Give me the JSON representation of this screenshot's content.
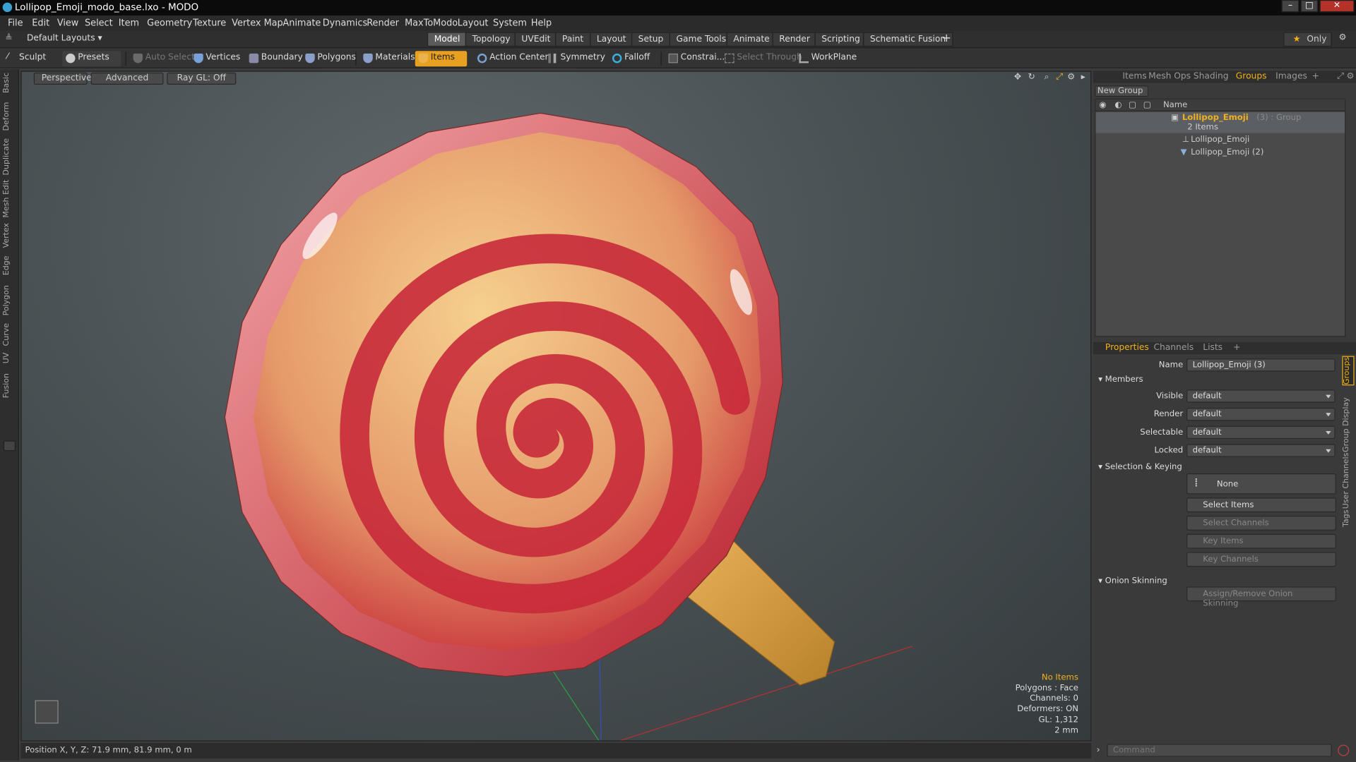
{
  "window": {
    "title": "Lollipop_Emoji_modo_base.lxo - MODO"
  },
  "menu": [
    "File",
    "Edit",
    "View",
    "Select",
    "Item",
    "Geometry",
    "Texture",
    "Vertex Map",
    "Animate",
    "Dynamics",
    "Render",
    "MaxToModo",
    "Layout",
    "System",
    "Help"
  ],
  "layout_select": "Default Layouts ▾",
  "layout_tabs": [
    "Model",
    "Topology",
    "UVEdit",
    "Paint",
    "Layout",
    "Setup",
    "Game Tools",
    "Animate",
    "Render",
    "Scripting",
    "Schematic Fusion"
  ],
  "only_label": "Only",
  "toolbar": {
    "sculpt": "Sculpt",
    "presets": "Presets",
    "auto_select": "Auto Select",
    "vertices": "Vertices",
    "boundary": "Boundary",
    "polygons": "Polygons",
    "materials": "Materials",
    "items": "Items",
    "action_center": "Action Center",
    "symmetry": "Symmetry",
    "falloff": "Falloff",
    "constraints": "Constrai...",
    "select_through": "Select Through",
    "workplane": "WorkPlane"
  },
  "left_tabs": [
    "Basic",
    "Deform",
    "Duplicate",
    "Mesh Edit",
    "Vertex",
    "Edge",
    "Polygon",
    "Curve",
    "UV",
    "Fusion"
  ],
  "viewport": {
    "perspective": "Perspective",
    "advanced": "Advanced",
    "raygl": "Ray GL: Off",
    "info": {
      "no_items": "No Items",
      "polygons": "Polygons : Face",
      "channels": "Channels: 0",
      "deformers": "Deformers: ON",
      "gl": "GL: 1,312",
      "scale": "2 mm"
    }
  },
  "status": {
    "position": "Position X, Y, Z:   71.9 mm, 81.9 mm, 0 m"
  },
  "right_panel": {
    "tabs": [
      "Items",
      "Mesh Ops",
      "Shading",
      "Groups",
      "Images"
    ],
    "new_group": "New Group",
    "name_col": "Name",
    "group": {
      "name": "Lollipop_Emoji",
      "suffix": "(3) : Group",
      "count": "2 Items",
      "children": [
        "Lollipop_Emoji",
        "Lollipop_Emoji (2)"
      ]
    },
    "prop_tabs": [
      "Properties",
      "Channels",
      "Lists"
    ],
    "props": {
      "name_label": "Name",
      "name_value": "Lollipop_Emoji (3)",
      "members": "Members",
      "visible_label": "Visible",
      "render_label": "Render",
      "selectable_label": "Selectable",
      "locked_label": "Locked",
      "default": "default",
      "selection_keying": "Selection & Keying",
      "none": "None",
      "select_items": "Select Items",
      "select_channels": "Select Channels",
      "key_items": "Key Items",
      "key_channels": "Key Channels",
      "onion": "Onion Skinning",
      "assign_onion": "Assign/Remove Onion Skinning"
    },
    "side_tabs": [
      "Groups",
      "Group Display",
      "User Channels",
      "Tags"
    ],
    "command_placeholder": "Command"
  },
  "colors": {
    "accent": "#f2b11a",
    "candy_red": "#c8303a",
    "candy_yellow": "#f0c27a",
    "stick": "#d89a3a"
  }
}
